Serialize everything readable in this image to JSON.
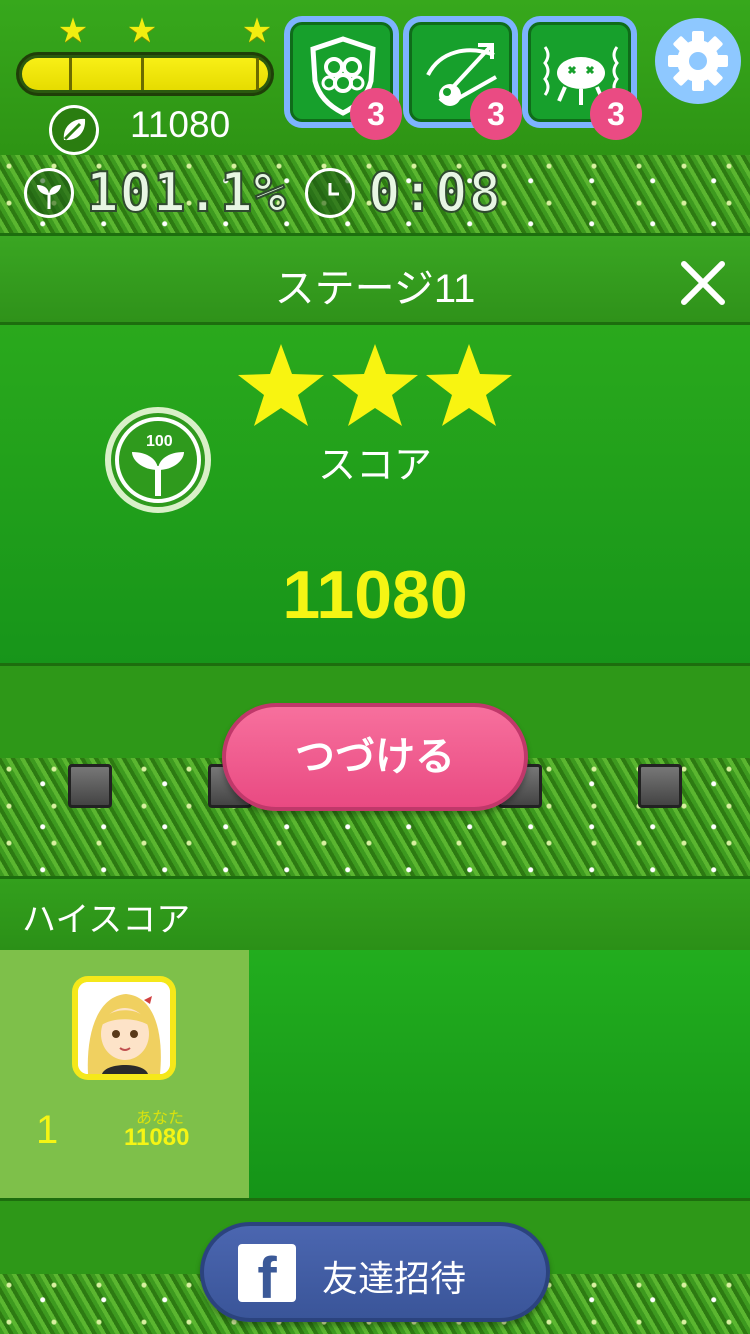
{
  "hud": {
    "star_progress": {
      "stars_earned": 3,
      "stars_total": 3,
      "fill_fraction": 1.0
    },
    "coins": "11080",
    "boosters": [
      {
        "name": "hex-shield-booster",
        "count": "3"
      },
      {
        "name": "shot-arrows-booster",
        "count": "3"
      },
      {
        "name": "shake-bug-booster",
        "count": "3"
      }
    ]
  },
  "stats": {
    "growth": "101.1%",
    "time": "0:08"
  },
  "result": {
    "title": "ステージ11",
    "stars": 3,
    "score_label": "スコア",
    "score": "11080",
    "sprout_badge": "100",
    "continue_label": "つづける"
  },
  "highscore": {
    "title": "ハイスコア",
    "entries": [
      {
        "rank": "1",
        "name": "あなた",
        "score": "11080"
      }
    ]
  },
  "invite": {
    "label": "友達招待",
    "logo_letter": "f"
  },
  "colors": {
    "accent_pink": "#e94a82",
    "score_yellow": "#f5f514",
    "panel_green": "#1ea01c",
    "facebook_blue": "#3b5998",
    "booster_blue": "#7db3ff"
  }
}
